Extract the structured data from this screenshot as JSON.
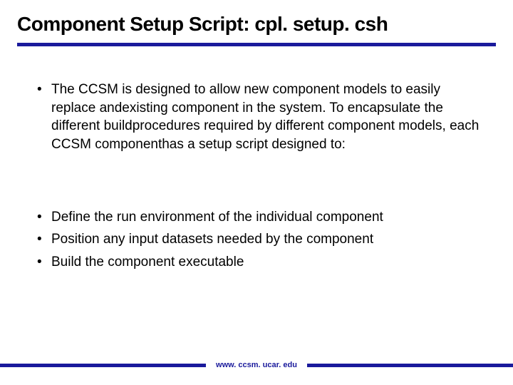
{
  "title": "Component Setup Script:  cpl. setup. csh",
  "bullets_a": [
    "The CCSM is designed to allow new component models to easily replace andexisting component in the system.  To encapsulate the different buildprocedures required by different component models, each CCSM componenthas a setup script designed to:"
  ],
  "bullets_b": [
    "Define the run environment of the individual component",
    "Position any input datasets needed by the component",
    "Build the component executable"
  ],
  "footer": "www. ccsm. ucar. edu"
}
